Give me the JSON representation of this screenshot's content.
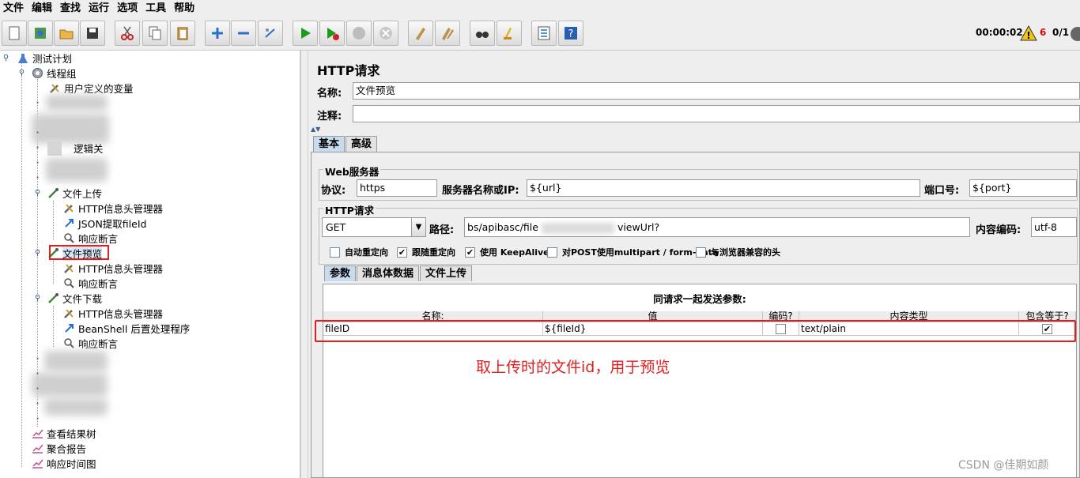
{
  "menu": [
    "文件",
    "编辑",
    "查找",
    "运行",
    "选项",
    "工具",
    "帮助"
  ],
  "toolbar": {
    "timer": "00:00:02",
    "warning_count": "6",
    "thread_ratio": "0/1"
  },
  "tree": {
    "root": "测试计划",
    "thread_group": "线程组",
    "user_vars": "用户定义的变量",
    "partial_label": "逻辑关",
    "upload": "文件上传",
    "upload_children": [
      "HTTP信息头管理器",
      "JSON提取fileId",
      "响应断言"
    ],
    "preview": "文件预览",
    "preview_children": [
      "HTTP信息头管理器",
      "响应断言"
    ],
    "download": "文件下载",
    "download_children": [
      "HTTP信息头管理器",
      "BeanShell 后置处理程序",
      "响应断言"
    ],
    "listeners": [
      "查看结果树",
      "聚合报告",
      "响应时间图"
    ]
  },
  "http_request": {
    "panel_title": "HTTP请求",
    "name_label": "名称:",
    "name_value": "文件预览",
    "comment_label": "注释:",
    "comment_value": "",
    "tabs": [
      "基本",
      "高级"
    ],
    "web_server": {
      "group_title": "Web服务器",
      "protocol_label": "协议:",
      "protocol_value": "https",
      "server_label": "服务器名称或IP:",
      "server_value": "${url}",
      "port_label": "端口号:",
      "port_value": "${port}"
    },
    "request": {
      "group_title": "HTTP请求",
      "method": "GET",
      "path_label": "路径:",
      "path_value_start": "bs/apibasc/file",
      "path_value_end": "viewUrl?",
      "encoding_label": "内容编码:",
      "encoding_value": "utf-8"
    },
    "options": [
      {
        "label": "自动重定向",
        "checked": false
      },
      {
        "label": "跟随重定向",
        "checked": true
      },
      {
        "label": "使用 KeepAlive",
        "checked": true
      },
      {
        "label": "对POST使用multipart / form-data",
        "checked": false
      },
      {
        "label": "与浏览器兼容的头",
        "checked": false
      }
    ],
    "param_tabs": [
      "参数",
      "消息体数据",
      "文件上传"
    ],
    "params_caption": "同请求一起发送参数:",
    "columns": [
      "名称:",
      "值",
      "编码?",
      "内容类型",
      "包含等于?"
    ],
    "rows": [
      {
        "name": "fileID",
        "value": "${fileId}",
        "encode": false,
        "content_type": "text/plain",
        "include_equals": true
      }
    ]
  },
  "annotation": "取上传时的文件id，用于预览",
  "watermark": "CSDN @佳期如颜"
}
